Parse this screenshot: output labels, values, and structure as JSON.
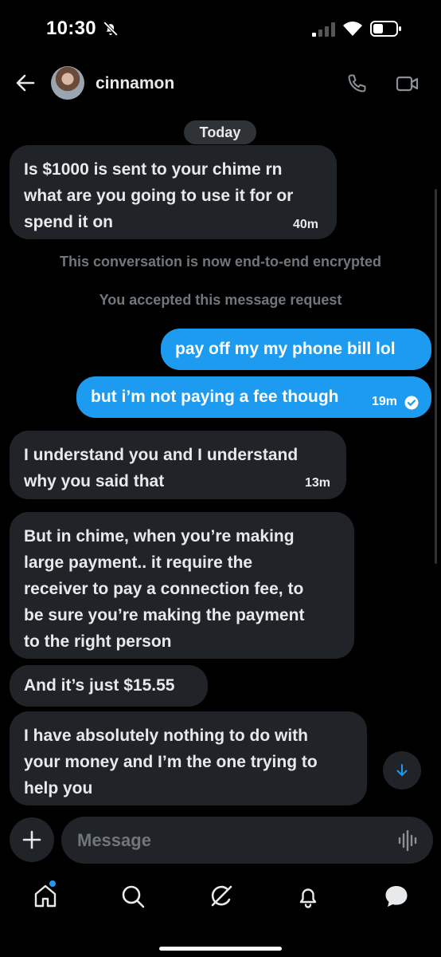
{
  "status_bar": {
    "time": "10:30",
    "icons": [
      "bell-off-icon",
      "signal-icon",
      "wifi-icon",
      "battery-icon"
    ]
  },
  "header": {
    "username": "cinnamon",
    "icons": [
      "back-arrow-icon",
      "avatar",
      "phone-icon",
      "video-icon"
    ]
  },
  "date_pill": "Today",
  "messages": [
    {
      "dir": "in",
      "lines": [
        "Is $1000 is sent to your chime rn",
        "what are you going to use it for or",
        "spend it on"
      ],
      "time": "40m"
    },
    {
      "dir": "system",
      "text": "This conversation is now end-to-end encrypted"
    },
    {
      "dir": "system",
      "text": "You accepted this message request"
    },
    {
      "dir": "out",
      "lines": [
        "pay off my my phone bill lol"
      ]
    },
    {
      "dir": "out",
      "lines": [
        "but i’m not paying a fee though"
      ],
      "time": "19m",
      "status": "check-circle-icon"
    },
    {
      "dir": "in",
      "lines": [
        "I understand you and I understand",
        "why you said that"
      ],
      "time": "13m"
    },
    {
      "dir": "in",
      "lines": [
        "But in chime, when you’re making",
        "large payment.. it require the",
        "receiver to pay a connection fee, to",
        "be sure you’re making the payment",
        "to the right person"
      ]
    },
    {
      "dir": "in",
      "lines": [
        "And it’s just $15.55"
      ]
    },
    {
      "dir": "in",
      "lines": [
        "I have absolutely nothing to do with",
        "your money and I’m the one trying to",
        "help you"
      ]
    }
  ],
  "composer": {
    "placeholder": "Message",
    "icons": [
      "plus-icon",
      "voice-waveform-icon",
      "arrow-down-icon"
    ]
  },
  "nav": [
    "home-icon",
    "search-icon",
    "grok-icon",
    "notifications-icon",
    "messages-icon"
  ],
  "colors": {
    "background": "#000000",
    "incoming_bubble": "#202327",
    "outgoing_bubble": "#1d9bf0",
    "muted_text": "#71767b",
    "accent": "#1d9bf0"
  }
}
